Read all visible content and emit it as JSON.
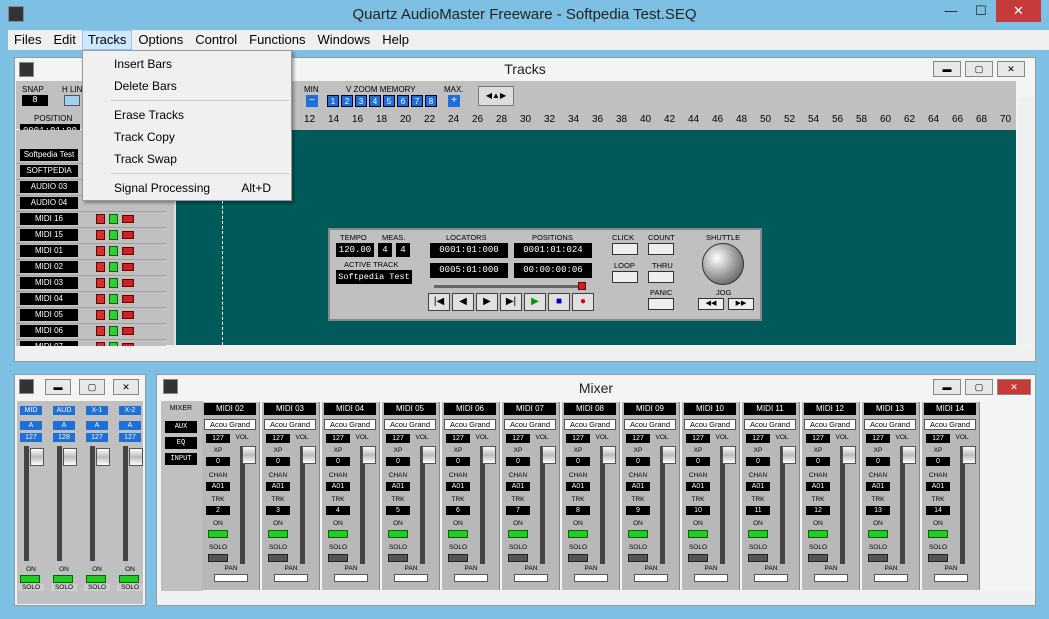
{
  "app": {
    "title": "Quartz AudioMaster Freeware - Softpedia Test.SEQ"
  },
  "window_buttons": {
    "minimize": "—",
    "maximize": "☐",
    "close": "✕"
  },
  "menubar": [
    "Files",
    "Edit",
    "Tracks",
    "Options",
    "Control",
    "Functions",
    "Windows",
    "Help"
  ],
  "tracks_menu": {
    "items": [
      {
        "label": "Insert Bars",
        "shortcut": ""
      },
      {
        "label": "Delete Bars",
        "shortcut": ""
      },
      {
        "label": "Erase Tracks",
        "shortcut": ""
      },
      {
        "label": "Track Copy",
        "shortcut": ""
      },
      {
        "label": "Track Swap",
        "shortcut": ""
      },
      {
        "label": "Signal Processing",
        "shortcut": "Alt+D"
      }
    ]
  },
  "tracks_window": {
    "title": "Tracks",
    "snap_label": "SNAP",
    "snap_value": "8",
    "hlines_label": "H LIN",
    "position_label": "POSITION",
    "position_value": "0001:01:00",
    "min_label": "MIN",
    "vzoom_label": "V ZOOM MEMORY",
    "max_label": "MAX.",
    "zoom_slots": [
      "1",
      "2",
      "3",
      "4",
      "5",
      "6",
      "7",
      "8"
    ],
    "ruler": [
      "12",
      "14",
      "16",
      "18",
      "20",
      "22",
      "24",
      "26",
      "28",
      "30",
      "32",
      "34",
      "36",
      "38",
      "40",
      "42",
      "44",
      "46",
      "48",
      "50",
      "52",
      "54",
      "56",
      "58",
      "60",
      "62",
      "64",
      "66",
      "68",
      "70"
    ],
    "track_names": [
      "Softpedia Test",
      "SOFTPEDIA",
      "AUDIO 03",
      "AUDIO 04",
      "MIDI 16",
      "MIDI 15",
      "MIDI 01",
      "MIDI 02",
      "MIDI 03",
      "MIDI 04",
      "MIDI 05",
      "MIDI 06",
      "MIDI 07"
    ]
  },
  "transport": {
    "tempo_label": "TEMPO",
    "tempo_value": "120.00",
    "meas_label": "MEAS.",
    "meas_num": "4",
    "meas_den": "4",
    "active_track_label": "ACTIVE TRACK",
    "active_track_value": "Softpedia Test",
    "locators_label": "LOCATORS",
    "locator_1": "0001:01:000",
    "locator_2": "0005:01:000",
    "positions_label": "POSITIONS",
    "position_1": "0001:01:024",
    "position_2": "00:00:00:06",
    "click_label": "CLICK",
    "count_label": "COUNT",
    "loop_label": "LOOP",
    "thru_label": "THRU",
    "panic_label": "PANIC",
    "shuttle_label": "SHUTTLE",
    "jog_label": "JOG",
    "buttons": [
      "|◀",
      "◀",
      "▶",
      "▶|",
      "▶",
      "■",
      "●"
    ]
  },
  "left_mixer": {
    "strips": [
      {
        "name": "MID",
        "ch": "A",
        "val": "127"
      },
      {
        "name": "AUD",
        "ch": "A",
        "val": "128"
      },
      {
        "name": "X-1",
        "ch": "A",
        "val": "127"
      },
      {
        "name": "X-2",
        "ch": "A",
        "val": "127"
      }
    ],
    "on_label": "ON",
    "solo_label": "SOLO"
  },
  "mixer": {
    "title": "Mixer",
    "side": [
      "MIXER",
      "AUX",
      "EQ",
      "INPUT"
    ],
    "labels": {
      "vol": "VOL",
      "xp": "XP",
      "chan": "CHAN",
      "trk": "TRK",
      "on": "ON",
      "solo": "SOLO",
      "pan": "PAN"
    },
    "strips": [
      {
        "name": "MIDI 02",
        "inst": "Acou Grand",
        "vol": "127",
        "xp": "0",
        "chan": "A01",
        "trk": "2"
      },
      {
        "name": "MIDI 03",
        "inst": "Acou Grand",
        "vol": "127",
        "xp": "0",
        "chan": "A01",
        "trk": "3"
      },
      {
        "name": "MIDI 04",
        "inst": "Acou Grand",
        "vol": "127",
        "xp": "0",
        "chan": "A01",
        "trk": "4"
      },
      {
        "name": "MIDI 05",
        "inst": "Acou Grand",
        "vol": "127",
        "xp": "0",
        "chan": "A01",
        "trk": "5"
      },
      {
        "name": "MIDI 06",
        "inst": "Acou Grand",
        "vol": "127",
        "xp": "0",
        "chan": "A01",
        "trk": "6"
      },
      {
        "name": "MIDI 07",
        "inst": "Acou Grand",
        "vol": "127",
        "xp": "0",
        "chan": "A01",
        "trk": "7"
      },
      {
        "name": "MIDI 08",
        "inst": "Acou Grand",
        "vol": "127",
        "xp": "0",
        "chan": "A01",
        "trk": "8"
      },
      {
        "name": "MIDI 09",
        "inst": "Acou Grand",
        "vol": "127",
        "xp": "0",
        "chan": "A01",
        "trk": "9"
      },
      {
        "name": "MIDI 10",
        "inst": "Acou Grand",
        "vol": "127",
        "xp": "0",
        "chan": "A01",
        "trk": "10"
      },
      {
        "name": "MIDI 11",
        "inst": "Acou Grand",
        "vol": "127",
        "xp": "0",
        "chan": "A01",
        "trk": "11"
      },
      {
        "name": "MIDI 12",
        "inst": "Acou Grand",
        "vol": "127",
        "xp": "0",
        "chan": "A01",
        "trk": "12"
      },
      {
        "name": "MIDI 13",
        "inst": "Acou Grand",
        "vol": "127",
        "xp": "0",
        "chan": "A01",
        "trk": "13"
      },
      {
        "name": "MIDI 14",
        "inst": "Acou Grand",
        "vol": "127",
        "xp": "0",
        "chan": "A01",
        "trk": "14"
      }
    ]
  },
  "colors": {
    "titlebar": "#7ec0e4",
    "track_area": "#005a5a",
    "close_red": "#c73a3a"
  }
}
